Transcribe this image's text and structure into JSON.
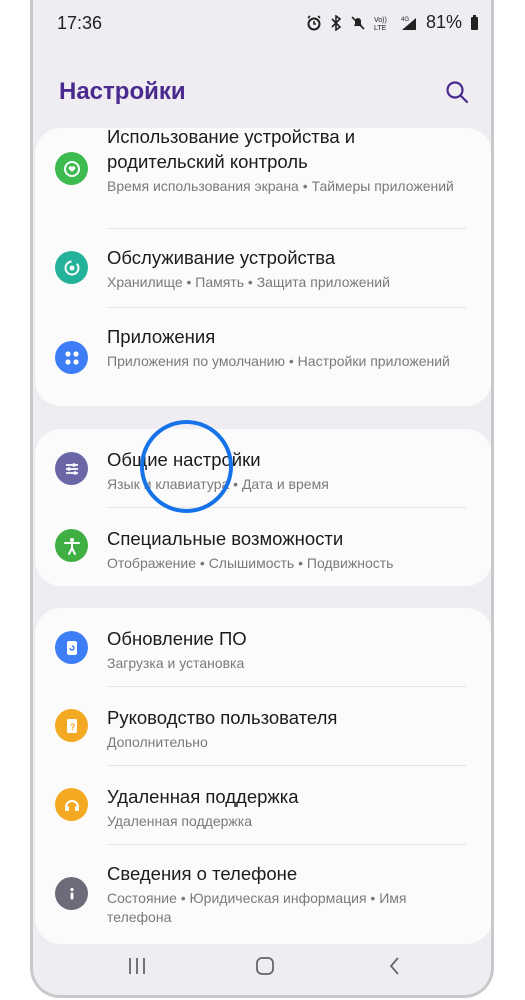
{
  "status": {
    "time": "17:36",
    "battery": "81%",
    "icons": [
      "alarm-icon",
      "bluetooth-icon",
      "mute-icon",
      "volte-icon",
      "signal-4g-icon",
      "battery-icon"
    ]
  },
  "header": {
    "title": "Настройки",
    "search_icon": "search-icon"
  },
  "groups": [
    {
      "items": [
        {
          "title": "Использование устройства и родительский контроль",
          "sub": "Время использования экрана • Таймеры приложений",
          "icon": "digital-wellbeing-icon",
          "color": "#3dbb4f"
        },
        {
          "title": "Обслуживание устройства",
          "sub": "Хранилище • Память • Защита приложений",
          "icon": "device-care-icon",
          "color": "#25b29a"
        },
        {
          "title": "Приложения",
          "sub": "Приложения по умолчанию • Настройки приложений",
          "icon": "apps-icon",
          "color": "#3d7ef6"
        }
      ]
    },
    {
      "items": [
        {
          "title": "Общие настройки",
          "sub": "Язык и клавиатура • Дата и время",
          "icon": "general-settings-icon",
          "color": "#6b67a6"
        },
        {
          "title": "Специальные возможности",
          "sub": "Отображение • Слышимость • Подвижность",
          "icon": "accessibility-icon",
          "color": "#3fae43"
        }
      ]
    },
    {
      "items": [
        {
          "title": "Обновление ПО",
          "sub": "Загрузка и установка",
          "icon": "software-update-icon",
          "color": "#3d7ef6"
        },
        {
          "title": "Руководство пользователя",
          "sub": "Дополнительно",
          "icon": "user-manual-icon",
          "color": "#f4a922"
        },
        {
          "title": "Удаленная поддержка",
          "sub": "Удаленная поддержка",
          "icon": "remote-support-icon",
          "color": "#f4a922"
        },
        {
          "title": "Сведения о телефоне",
          "sub": "Состояние • Юридическая информация • Имя телефона",
          "icon": "about-phone-icon",
          "color": "#6b6b7a"
        }
      ]
    }
  ],
  "highlight_color": "#1672e8",
  "nav": [
    "recent-apps-icon",
    "home-icon",
    "back-icon"
  ]
}
